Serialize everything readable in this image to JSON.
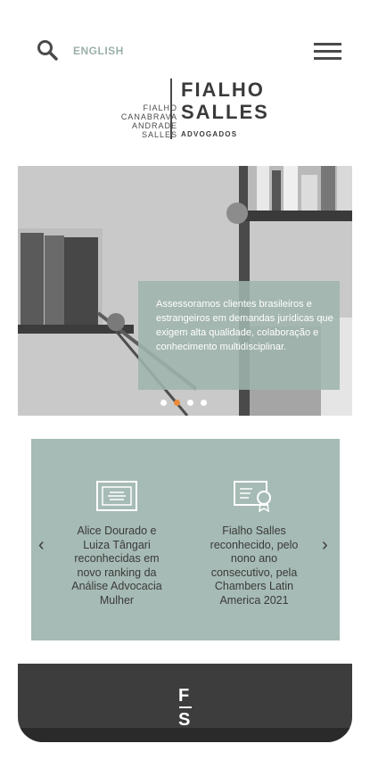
{
  "header": {
    "language_label": "ENGLISH",
    "icons": {
      "search": "search-icon",
      "menu": "hamburger-menu-icon"
    }
  },
  "logo": {
    "left_lines": [
      "FIALHO",
      "CANABRAVA",
      "ANDRADE",
      "SALLES"
    ],
    "main_line1": "FIALHO",
    "main_line2": "SALLES",
    "subtitle": "ADVOGADOS"
  },
  "hero": {
    "caption": "Assessoramos clientes brasileiros e estrangeiros em demandas jurídicas que exigem alta qualidade, colaboração e conhecimento multidisciplinar.",
    "slide_count": 4,
    "active_slide": 2
  },
  "news": {
    "items": [
      {
        "icon": "certificate-icon",
        "text": "Alice Dourado e Luiza Tângari reconhecidas em novo ranking da Análise Advocacia Mulher"
      },
      {
        "icon": "award-certificate-icon",
        "text": "Fialho Salles reconhecido, pelo nono ano consecutivo, pela Chambers Latin America 2021"
      }
    ],
    "prev_arrow": "‹",
    "next_arrow": "›"
  },
  "footer": {
    "mark_top": "F",
    "mark_bottom": "S"
  },
  "colors": {
    "accent": "#a6bbb5",
    "active_dot": "#e88a3a",
    "dark": "#3d3d3d"
  }
}
